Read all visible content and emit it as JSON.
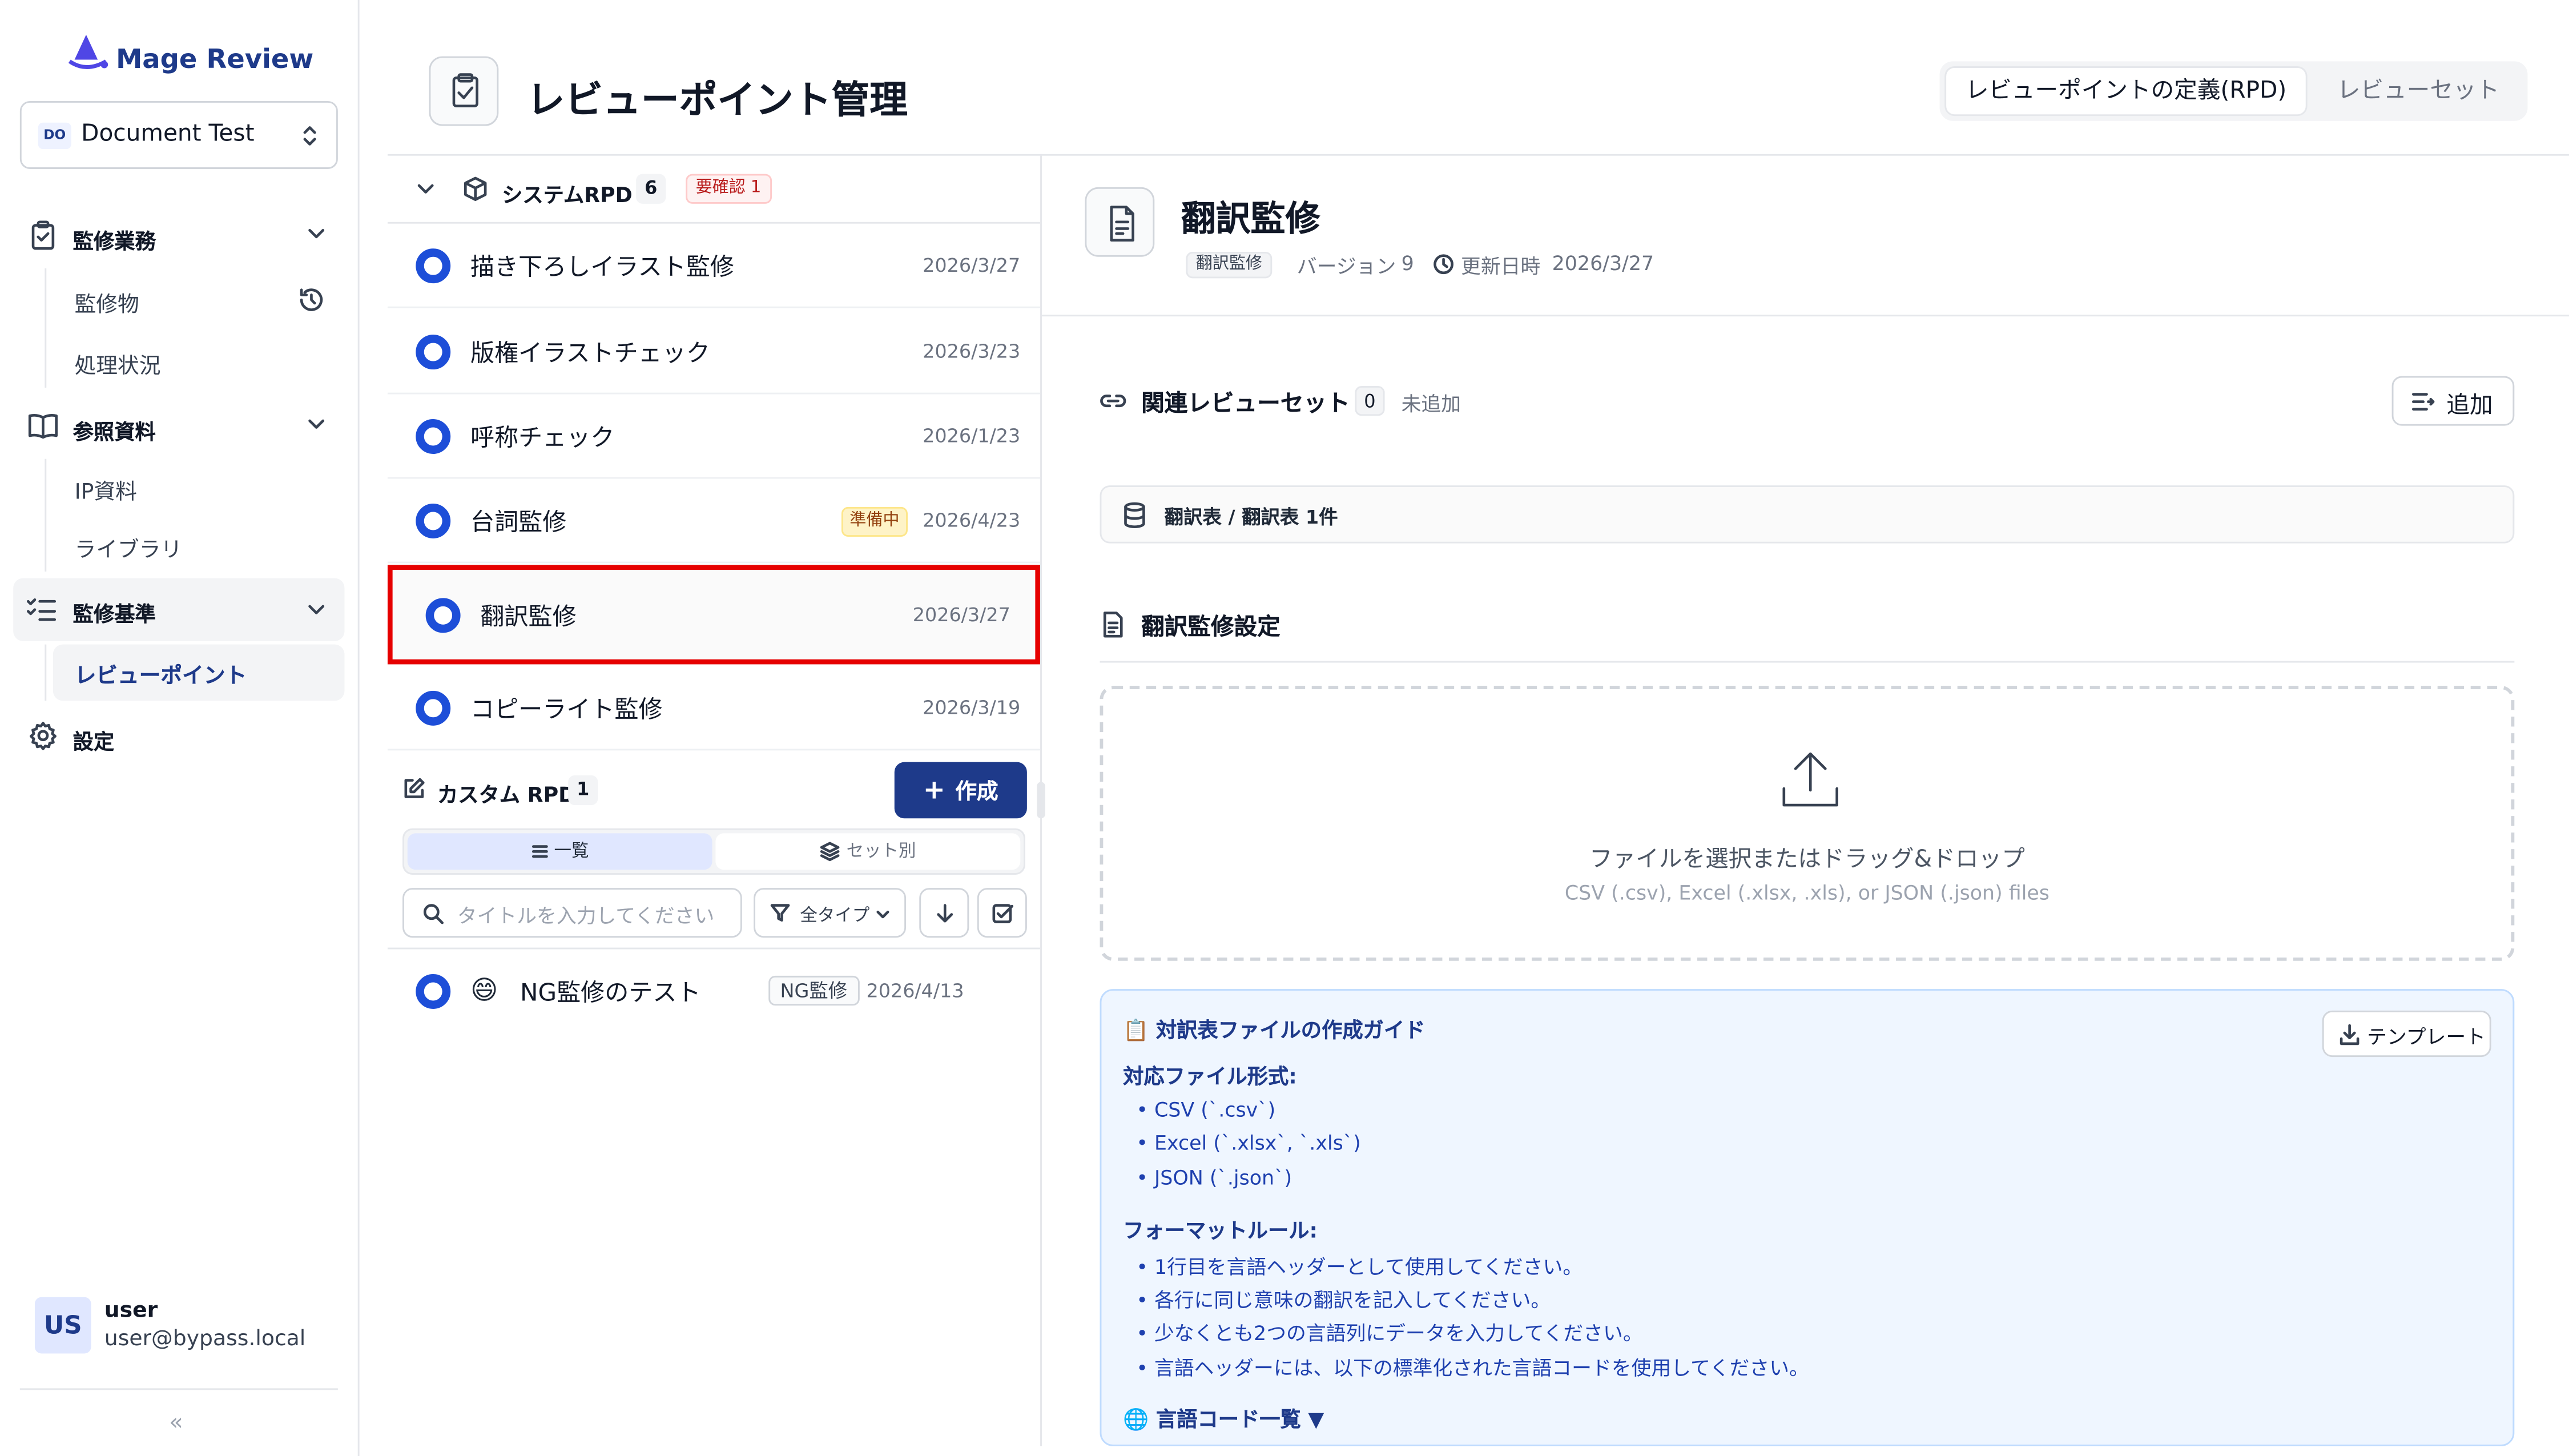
{
  "app": {
    "name": "Mage Review",
    "project_badge": "DO",
    "project_name": "Document Test"
  },
  "sidebar": {
    "groups": [
      {
        "label": "監修業務",
        "items": [
          {
            "label": "監修物"
          },
          {
            "label": "処理状況"
          }
        ]
      },
      {
        "label": "参照資料",
        "items": [
          {
            "label": "IP資料"
          },
          {
            "label": "ライブラリ"
          }
        ]
      },
      {
        "label": "監修基準",
        "items": [
          {
            "label": "レビューポイント"
          }
        ]
      }
    ],
    "settings_label": "設定",
    "user": {
      "avatar": "US",
      "name": "user",
      "email": "user@bypass.local"
    },
    "collapse_glyph": "«"
  },
  "header": {
    "title": "レビューポイント管理",
    "tabs": [
      {
        "label": "レビューポイントの定義(RPD)",
        "active": true
      },
      {
        "label": "レビューセット",
        "active": false
      }
    ]
  },
  "system_rpd": {
    "label": "システムRPD",
    "count": "6",
    "warning": "要確認 1",
    "items": [
      {
        "label": "描き下ろしイラスト監修",
        "date": "2026/3/27"
      },
      {
        "label": "版権イラストチェック",
        "date": "2026/3/23"
      },
      {
        "label": "呼称チェック",
        "date": "2026/1/23"
      },
      {
        "label": "台詞監修",
        "badge": "準備中",
        "date": "2026/4/23"
      },
      {
        "label": "翻訳監修",
        "date": "2026/3/27"
      },
      {
        "label": "コピーライト監修",
        "date": "2026/3/19"
      }
    ]
  },
  "custom_rpd": {
    "label": "カスタム RPD",
    "count": "1",
    "create_label": "作成",
    "create_glyph": "+",
    "view_tabs": [
      {
        "label": "一覧"
      },
      {
        "label": "セット別"
      }
    ],
    "search_placeholder": "タイトルを入力してください",
    "filter_label": "全タイプ",
    "items": [
      {
        "emoji": "😄",
        "label": "NG監修のテスト",
        "badge": "NG監修",
        "date": "2026/4/13"
      }
    ]
  },
  "detail": {
    "title": "翻訳監修",
    "tag": "翻訳監修",
    "version_label": "バージョン",
    "version": "9",
    "updated_label": "更新日時",
    "updated": "2026/3/27",
    "related_title": "関連レビューセット",
    "related_count": "0",
    "related_status": "未追加",
    "add_label": "追加",
    "table_label": "翻訳表 / 翻訳表 1件",
    "settings_title": "翻訳監修設定",
    "upload_main": "ファイルを選択またはドラッグ&ドロップ",
    "upload_sub": "CSV (.csv), Excel (.xlsx, .xls), or JSON (.json) files",
    "guide": {
      "title": "📋 対訳表ファイルの作成ガイド",
      "template_label": "テンプレート",
      "formats_title": "対応ファイル形式:",
      "formats": [
        "• CSV (`.csv`)",
        "• Excel (`.xlsx`, `.xls`)",
        "• JSON (`.json`)"
      ],
      "rules_title": "フォーマットルール:",
      "rules": [
        "• 1行目を言語ヘッダーとして使用してください。",
        "• 各行に同じ意味の翻訳を記入してください。",
        "• 少なくとも2つの言語列にデータを入力してください。",
        "• 言語ヘッダーには、以下の標準化された言語コードを使用してください。"
      ],
      "lang_codes": "🌐 言語コード一覧 ▼"
    }
  },
  "colors": {
    "accent": "#1e3a8a",
    "ring": "#1d4ed8",
    "highlight": "#e60000"
  }
}
